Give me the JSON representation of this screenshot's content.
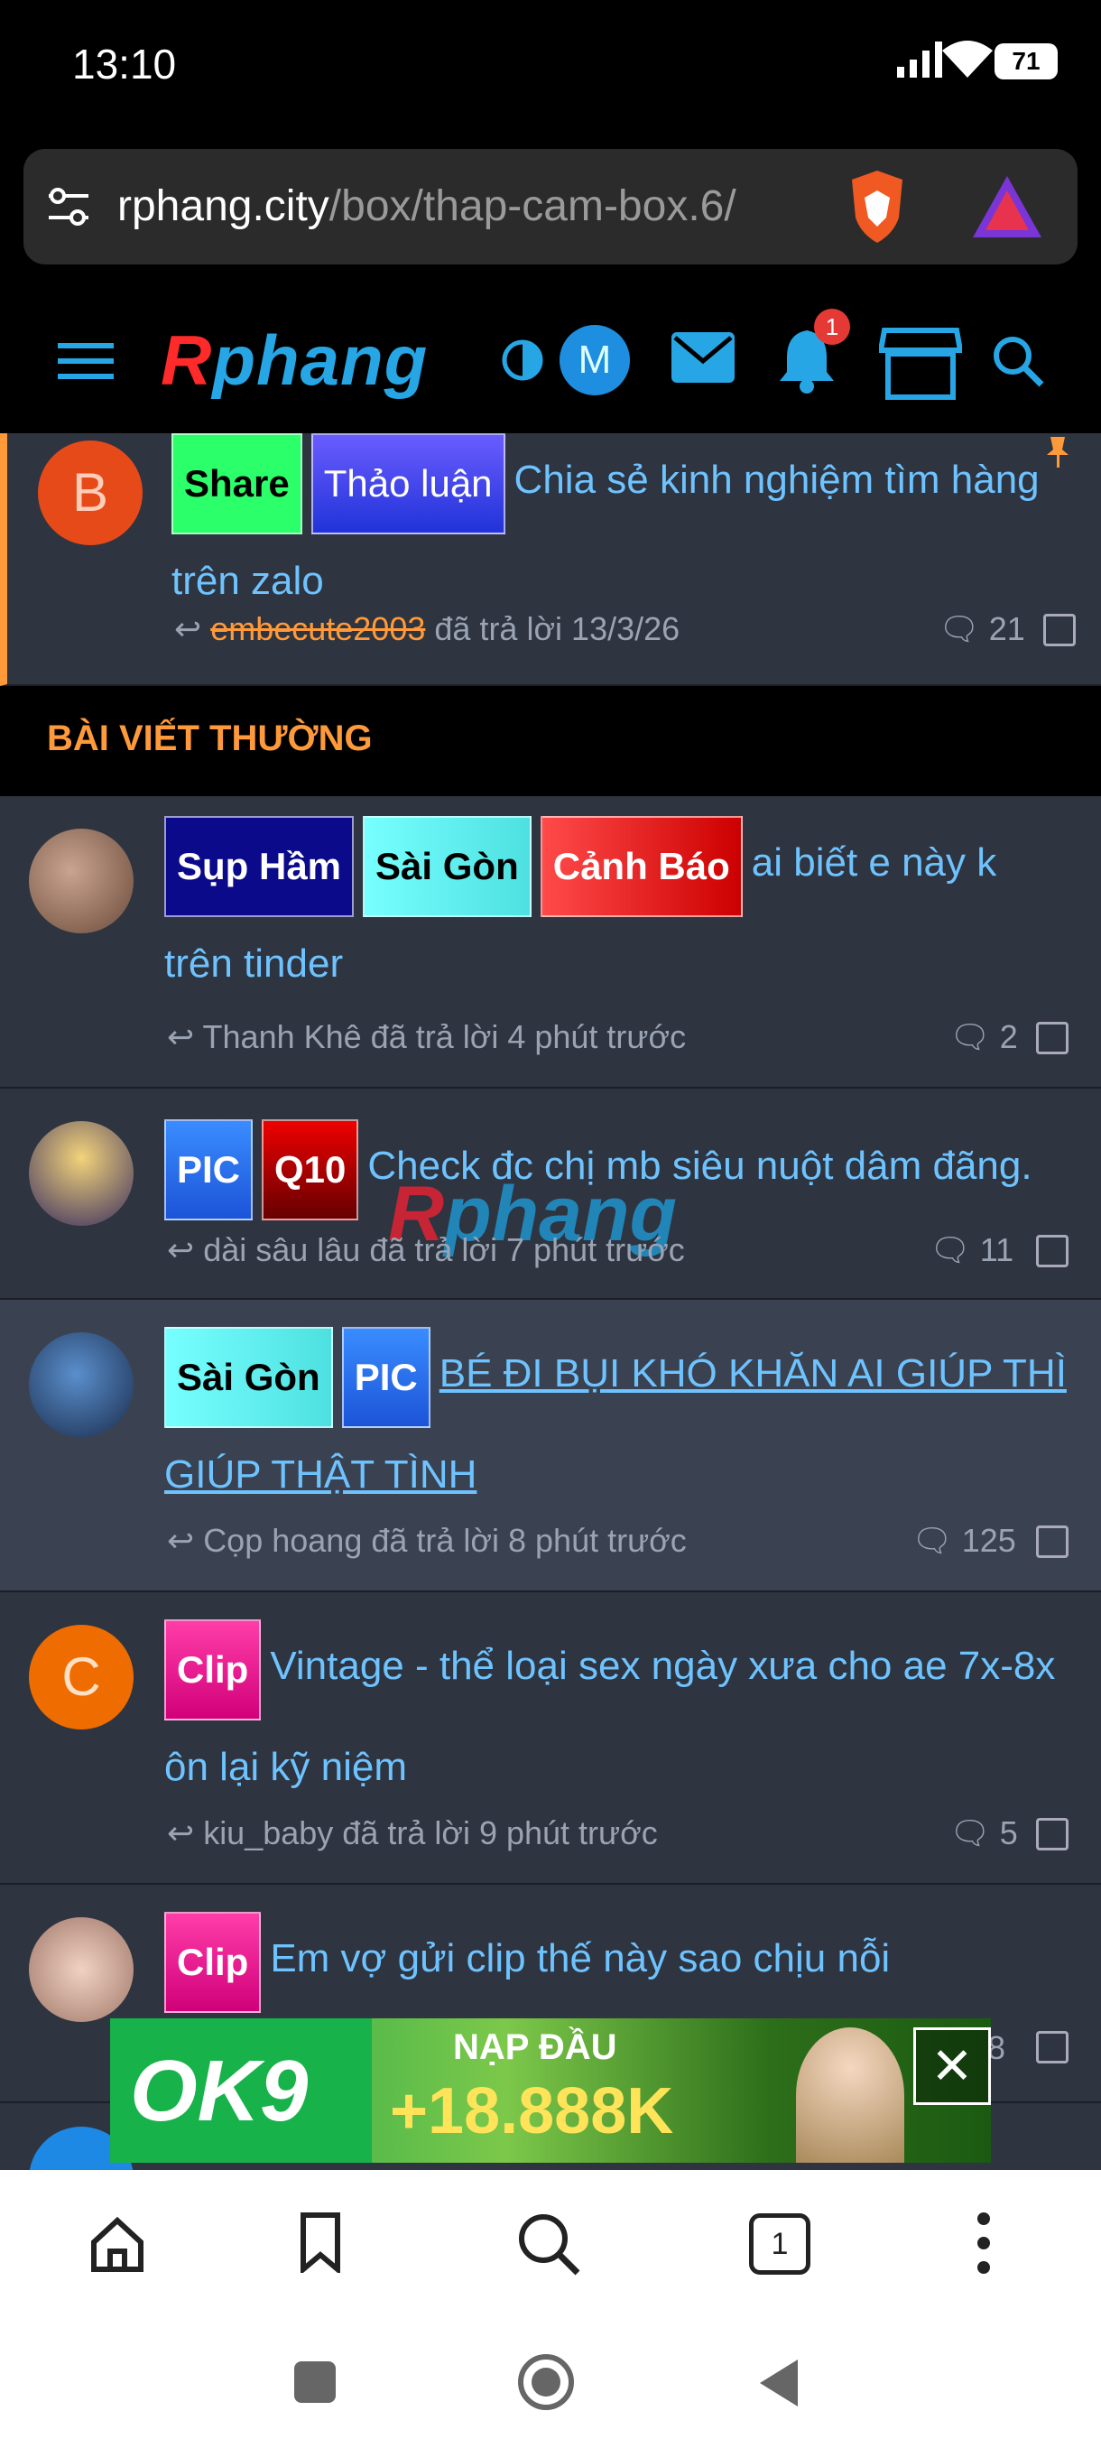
{
  "status_bar": {
    "time": "13:10",
    "battery": "71"
  },
  "url_bar": {
    "domain": "rphang.city",
    "path": "/box/thap-cam-box.6/"
  },
  "forum_header": {
    "logo_first": "R",
    "logo_rest": "phang",
    "avatar_letter": "M",
    "notification_count": "1"
  },
  "pinned_thread": {
    "avatar_letter": "B",
    "tags": [
      "Share",
      "Thảo luận"
    ],
    "title": "Chia sẻ kinh nghiệm tìm hàng trên zalo",
    "last_user": "embecute2003",
    "reply_text": "đã trả lời 13/3/26",
    "replies": "21"
  },
  "section_title": "BÀI VIẾT THƯỜNG",
  "threads": [
    {
      "tags": [
        "Sụp Hầm",
        "Sài Gòn",
        "Cảnh Báo"
      ],
      "title": "ai biết e này k trên tinder",
      "meta": "Thanh Khê đã trả lời 4 phút trước",
      "replies": "2"
    },
    {
      "tags": [
        "PIC",
        "Q10"
      ],
      "title": "Check đc chị mb siêu nuột dâm đãng.",
      "meta": "dài sâu lâu đã trả lời 7 phút trước",
      "replies": "11"
    },
    {
      "tags": [
        "Sài Gòn",
        "PIC"
      ],
      "title": "BÉ ĐI BỤI KHÓ KHĂN AI GIÚP THÌ GIÚP THẬT TÌNH",
      "meta": "Cọp hoang đã trả lời 8 phút trước",
      "replies": "125"
    },
    {
      "avatar_letter": "C",
      "tags": [
        "Clip"
      ],
      "title": "Vintage - thể loại sex ngày xưa cho ae 7x-8x ôn lại kỹ niệm",
      "meta": "kiu_baby đã trả lời 9 phút trước",
      "replies": "5"
    },
    {
      "tags": [
        "Clip"
      ],
      "title": "Em vợ gửi clip thế này sao chịu nỗi",
      "meta": "",
      "replies": "8"
    }
  ],
  "watermark": "Rphang",
  "ad": {
    "brand": "OK9",
    "headline": "NẠP ĐẦU",
    "amount": "+18.888K"
  },
  "browser_nav": {
    "tab_count": "1"
  },
  "colors": {
    "accent": "#6ec3ff",
    "section": "#ff9a3a",
    "row_bg": "#2e3440"
  }
}
